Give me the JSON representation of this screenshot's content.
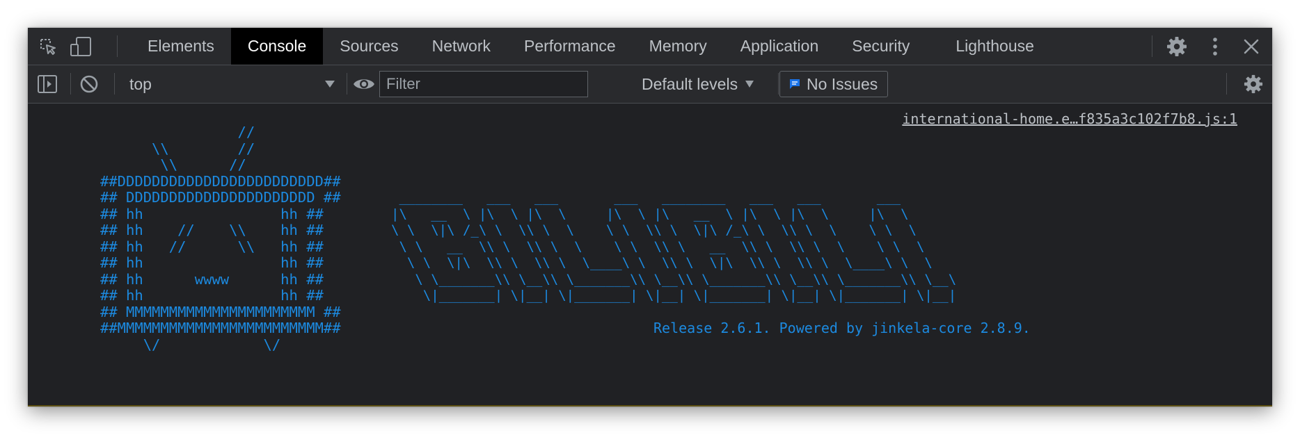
{
  "tabs": [
    "Elements",
    "Console",
    "Sources",
    "Network",
    "Performance",
    "Memory",
    "Application",
    "Security",
    "Lighthouse"
  ],
  "active_tab": "Console",
  "toolbar": {
    "context": "top",
    "filter_placeholder": "Filter",
    "levels": "Default levels",
    "issues": "No Issues"
  },
  "console": {
    "source_link": "international-home.e…f835a3c102f7b8.js:1",
    "art_left": "                //\n      \\\\        //\n       \\\\      //\n##DDDDDDDDDDDDDDDDDDDDDDDD##\n## DDDDDDDDDDDDDDDDDDDDDD ##\n## hh                hh ##\n## hh    //    \\\\    hh ##\n## hh   //      \\\\   hh ##\n## hh                hh ##\n## hh      wwww      hh ##\n## hh                hh ##\n## MMMMMMMMMMMMMMMMMMMMMM ##\n##MMMMMMMMMMMMMMMMMMMMMMMM##\n     \\/            \\/",
    "art_right": " ________   ___   ___       ___   ________   ___   ___       ___\n|\\   __  \\ |\\  \\ |\\  \\     |\\  \\ |\\   __  \\ |\\  \\ |\\  \\     |\\  \\\n\\ \\  \\|\\ /_\\ \\  \\\\ \\  \\    \\ \\  \\\\ \\  \\|\\ /_\\ \\  \\\\ \\  \\    \\ \\  \\\n \\ \\   __  \\\\ \\  \\\\ \\  \\    \\ \\  \\\\ \\   __  \\\\ \\  \\\\ \\  \\    \\ \\  \\\n  \\ \\  \\|\\  \\\\ \\  \\\\ \\  \\____\\ \\  \\\\ \\  \\|\\  \\\\ \\  \\\\ \\  \\____\\ \\  \\\n   \\ \\_______\\\\ \\__\\\\ \\_______\\\\ \\__\\\\ \\_______\\\\ \\__\\\\ \\_______\\\\ \\__\\\n    \\|_______| \\|__| \\|_______| \\|__| \\|_______| \\|__| \\|_______| \\|__|",
    "release": "Release 2.6.1. Powered by jinkela-core 2.8.9."
  },
  "colors": {
    "panel_bg": "#202124",
    "toolbar_bg": "#292a2d",
    "art_blue": "#1c8ae0",
    "text": "#bdc1c6",
    "issues_icon": "#1a73e8"
  },
  "icons": [
    "inspect-element-icon",
    "device-toolbar-icon",
    "settings-gear-icon",
    "more-options-icon",
    "close-icon",
    "sidebar-toggle-icon",
    "clear-console-icon",
    "dropdown-arrow-icon",
    "live-expression-eye-icon",
    "issues-message-icon",
    "console-settings-gear-icon"
  ]
}
